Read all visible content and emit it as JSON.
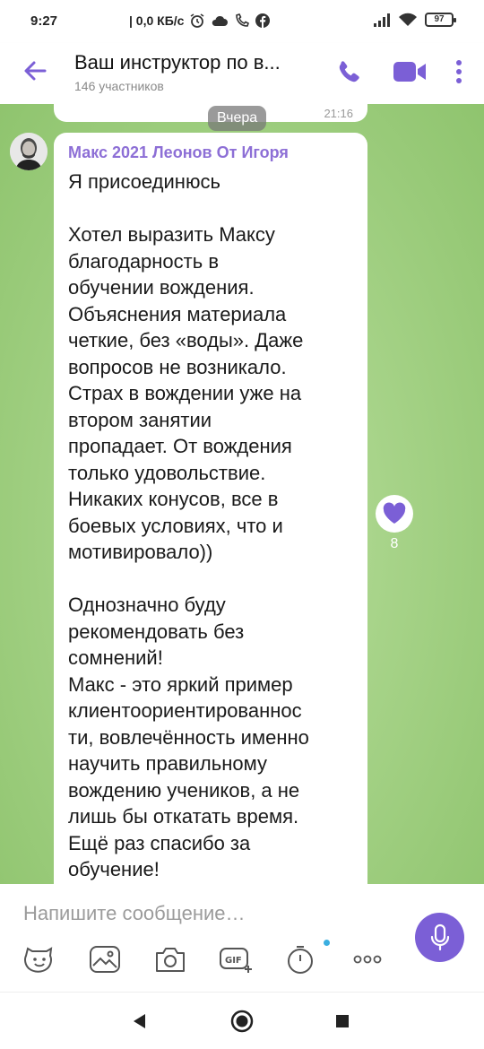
{
  "status_bar": {
    "time": "9:27",
    "net_speed": "| 0,0 КБ/с",
    "battery": "97",
    "icons": [
      "alarm-icon",
      "cloud-icon",
      "missed-call-icon",
      "facebook-icon",
      "signal-icon",
      "wifi-icon",
      "battery-icon"
    ]
  },
  "header": {
    "title": "Ваш инструктор по в...",
    "subtitle": "146 участников",
    "icons": [
      "back-arrow-icon",
      "phone-icon",
      "video-icon",
      "more-vert-icon"
    ],
    "accent_color": "#7b5fd6"
  },
  "chat": {
    "prev_message_time": "21:16",
    "date_separator": "Вчера",
    "message": {
      "sender": "Макс 2021 Леонов От Игоря",
      "text": "Я присоединюсь\n\nХотел выразить Максу\nблагодарность в\nобучении вождения.\nОбъяснения материала\nчеткие, без «воды». Даже\nвопросов не возникало.\nСтрах в вождении уже на\nвтором занятии\nпропадает. От вождения\nтолько удовольствие.\nНикаких конусов, все в\nбоевых условиях, что и\nмотивировало))\n\nОднозначно буду\nрекомендовать без\nсомнений!\nМакс - это яркий пример\nклиентоориентированнос\nти, вовлечённость именно\nнаучить правильному\nвождению учеников, а не\nлишь бы откатать время.\nЕщё раз спасибо за\nобучение!",
      "reaction_icon": "heart-icon",
      "reaction_count": "8"
    },
    "sender_color": "#8d6fd6"
  },
  "composer": {
    "placeholder": "Напишите сообщение…",
    "tools": [
      "sticker-icon",
      "gallery-icon",
      "camera-icon",
      "gif-icon",
      "timer-icon",
      "more-horiz-icon"
    ],
    "mic_icon": "mic-icon"
  },
  "nav_bar": {
    "icons": [
      "back-triangle-icon",
      "home-circle-icon",
      "recents-square-icon"
    ]
  }
}
